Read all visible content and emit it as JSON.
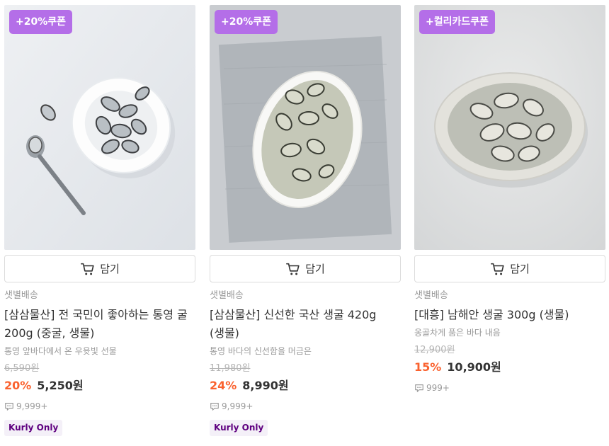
{
  "products": [
    {
      "coupon": "+20%쿠폰",
      "cart_label": "담기",
      "delivery": "샛별배송",
      "name": "[삼삼물산] 전 국민이 좋아하는 통영 굴 200g (중굴, 생물)",
      "description": "통영 앞바다에서 온 우윳빛 선물",
      "original_price": "6,590원",
      "discount_rate": "20%",
      "price": "5,250원",
      "review_count": "9,999+",
      "badge": "Kurly Only"
    },
    {
      "coupon": "+20%쿠폰",
      "cart_label": "담기",
      "delivery": "샛별배송",
      "name": "[삼삼물산] 신선한 국산 생굴 420g (생물)",
      "description": "통영 바다의 신선함을 머금은",
      "original_price": "11,980원",
      "discount_rate": "24%",
      "price": "8,990원",
      "review_count": "9,999+",
      "badge": "Kurly Only"
    },
    {
      "coupon": "+컬리카드쿠폰",
      "cart_label": "담기",
      "delivery": "샛별배송",
      "name": "[대흥] 남해안 생굴 300g (생물)",
      "description": "옹골차게 품은 바다 내음",
      "original_price": "12,900원",
      "discount_rate": "15%",
      "price": "10,900원",
      "review_count": "999+"
    }
  ],
  "colors": {
    "coupon_bg": "#b46ee8",
    "discount": "#fa622f",
    "badge_text": "#5f0080",
    "badge_bg": "#f4f0f8"
  },
  "icons": {
    "cart": "cart-icon",
    "review": "speech-bubble-icon"
  }
}
